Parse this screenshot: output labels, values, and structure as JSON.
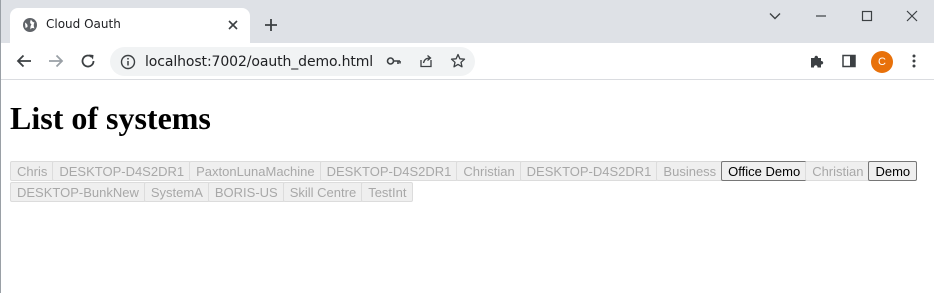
{
  "browser": {
    "tab_title": "Cloud Oauth",
    "url": "localhost:7002/oauth_demo.html",
    "profile_initial": "C",
    "profile_color": "#e8710a"
  },
  "page": {
    "heading": "List of systems",
    "systems": [
      {
        "label": "Chris",
        "enabled": false
      },
      {
        "label": "DESKTOP-D4S2DR1",
        "enabled": false
      },
      {
        "label": "PaxtonLunaMachine",
        "enabled": false
      },
      {
        "label": "DESKTOP-D4S2DR1",
        "enabled": false
      },
      {
        "label": "Christian",
        "enabled": false
      },
      {
        "label": "DESKTOP-D4S2DR1",
        "enabled": false
      },
      {
        "label": "Business",
        "enabled": false
      },
      {
        "label": "Office Demo",
        "enabled": true
      },
      {
        "label": "Christian",
        "enabled": false
      },
      {
        "label": "Demo",
        "enabled": true
      },
      {
        "label": "DESKTOP-BunkNew",
        "enabled": false
      },
      {
        "label": "SystemA",
        "enabled": false
      },
      {
        "label": "BORIS-US",
        "enabled": false
      },
      {
        "label": "Skill Centre",
        "enabled": false
      },
      {
        "label": "TestInt",
        "enabled": false
      }
    ]
  }
}
